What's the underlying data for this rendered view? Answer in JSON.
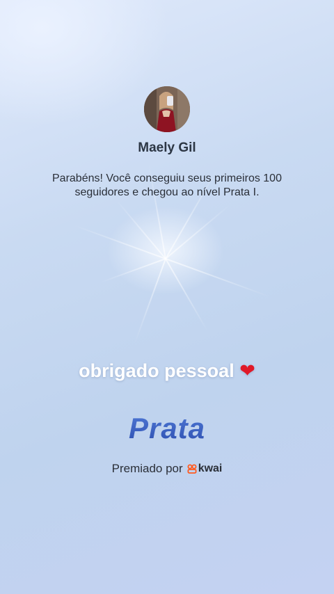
{
  "profile": {
    "name": "Maely Gil",
    "avatar_icon": "profile-photo"
  },
  "message": {
    "line1": "Parabéns! Você conseguiu seus primeiros 100",
    "line2": "seguidores e chegou ao nível Prata I."
  },
  "caption": {
    "text": "obrigado pessoal",
    "emoji": "❤"
  },
  "tier": {
    "label": "Prata",
    "color": "#3a5fbf"
  },
  "awarded": {
    "prefix": "Premiado por",
    "brand": "kwai",
    "brand_color": "#ff5a1f"
  }
}
